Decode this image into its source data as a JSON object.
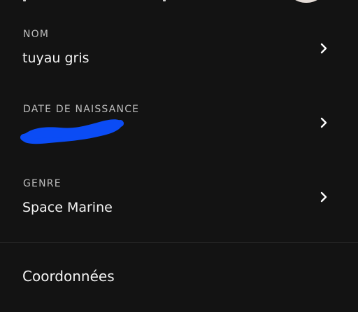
{
  "fields": [
    {
      "label": "NOM",
      "value": "tuyau gris"
    },
    {
      "label": "DATE DE NAISSANCE",
      "value": ""
    },
    {
      "label": "GENRE",
      "value": "Space Marine"
    }
  ],
  "contact_section": {
    "title": "Coordonnées"
  },
  "colors": {
    "background": "#131313",
    "label": "#bdbdbd",
    "value": "#f2f2f2",
    "redaction": "#0b4cf5"
  },
  "icons": {
    "row_action": "chevron-right-icon"
  }
}
